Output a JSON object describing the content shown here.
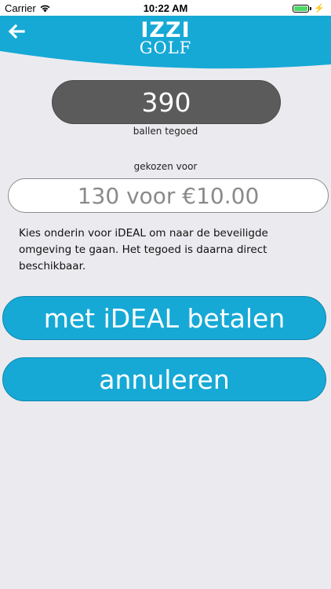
{
  "status_bar": {
    "carrier": "Carrier",
    "time": "10:22 AM",
    "battery_level": 1.0,
    "charging_symbol": "⚡"
  },
  "header": {
    "logo_top": "IZZI",
    "logo_bottom": "GOLF",
    "back_icon": "arrow-left-icon",
    "color": "#16a9d6"
  },
  "balance": {
    "value": "390",
    "label": "ballen tegoed"
  },
  "selection": {
    "label": "gekozen voor",
    "value": "130 voor €10.00"
  },
  "info_text": "Kies onderin voor iDEAL om naar de beveiligde omgeving te gaan. Het tegoed is daarna direct beschikbaar.",
  "buttons": {
    "pay_label": "met iDEAL betalen",
    "cancel_label": "annuleren"
  },
  "colors": {
    "accent": "#16a9d6",
    "pill_dark": "#5b5b5b",
    "background": "#ebebef"
  }
}
